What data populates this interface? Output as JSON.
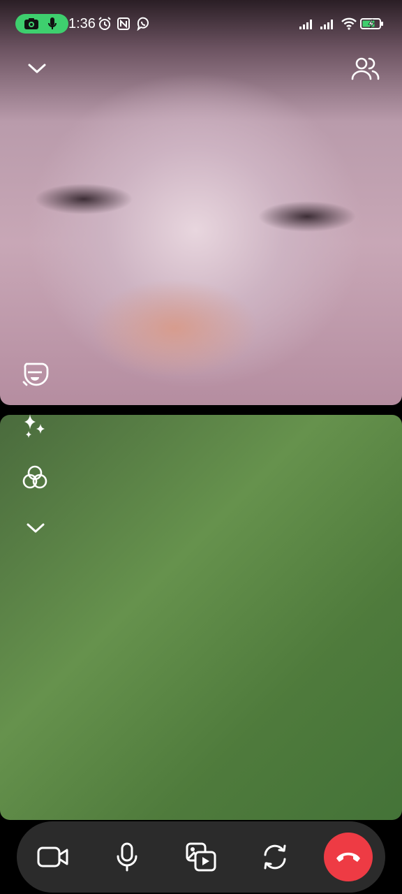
{
  "status_bar": {
    "time": "1:36",
    "icons": [
      "camera-icon",
      "mic-icon",
      "alarm-icon",
      "nfc-icon",
      "viber-icon",
      "signal-icon",
      "signal-icon",
      "wifi-icon",
      "battery-charging-icon"
    ]
  },
  "colors": {
    "recording_pill": "#3ecf6e",
    "control_bar": "#2b2b2b",
    "end_call": "#ee3b44"
  },
  "top_tile": {
    "icons": [
      "chevron-down-icon",
      "participants-icon",
      "face-mask-icon"
    ]
  },
  "bottom_tile": {
    "icons": [
      "sparkles-icon",
      "filters-icon",
      "chevron-down-icon"
    ]
  },
  "control_bar": {
    "icons": [
      "video-camera-icon",
      "microphone-icon",
      "media-share-icon",
      "switch-camera-icon",
      "end-call-icon"
    ]
  }
}
